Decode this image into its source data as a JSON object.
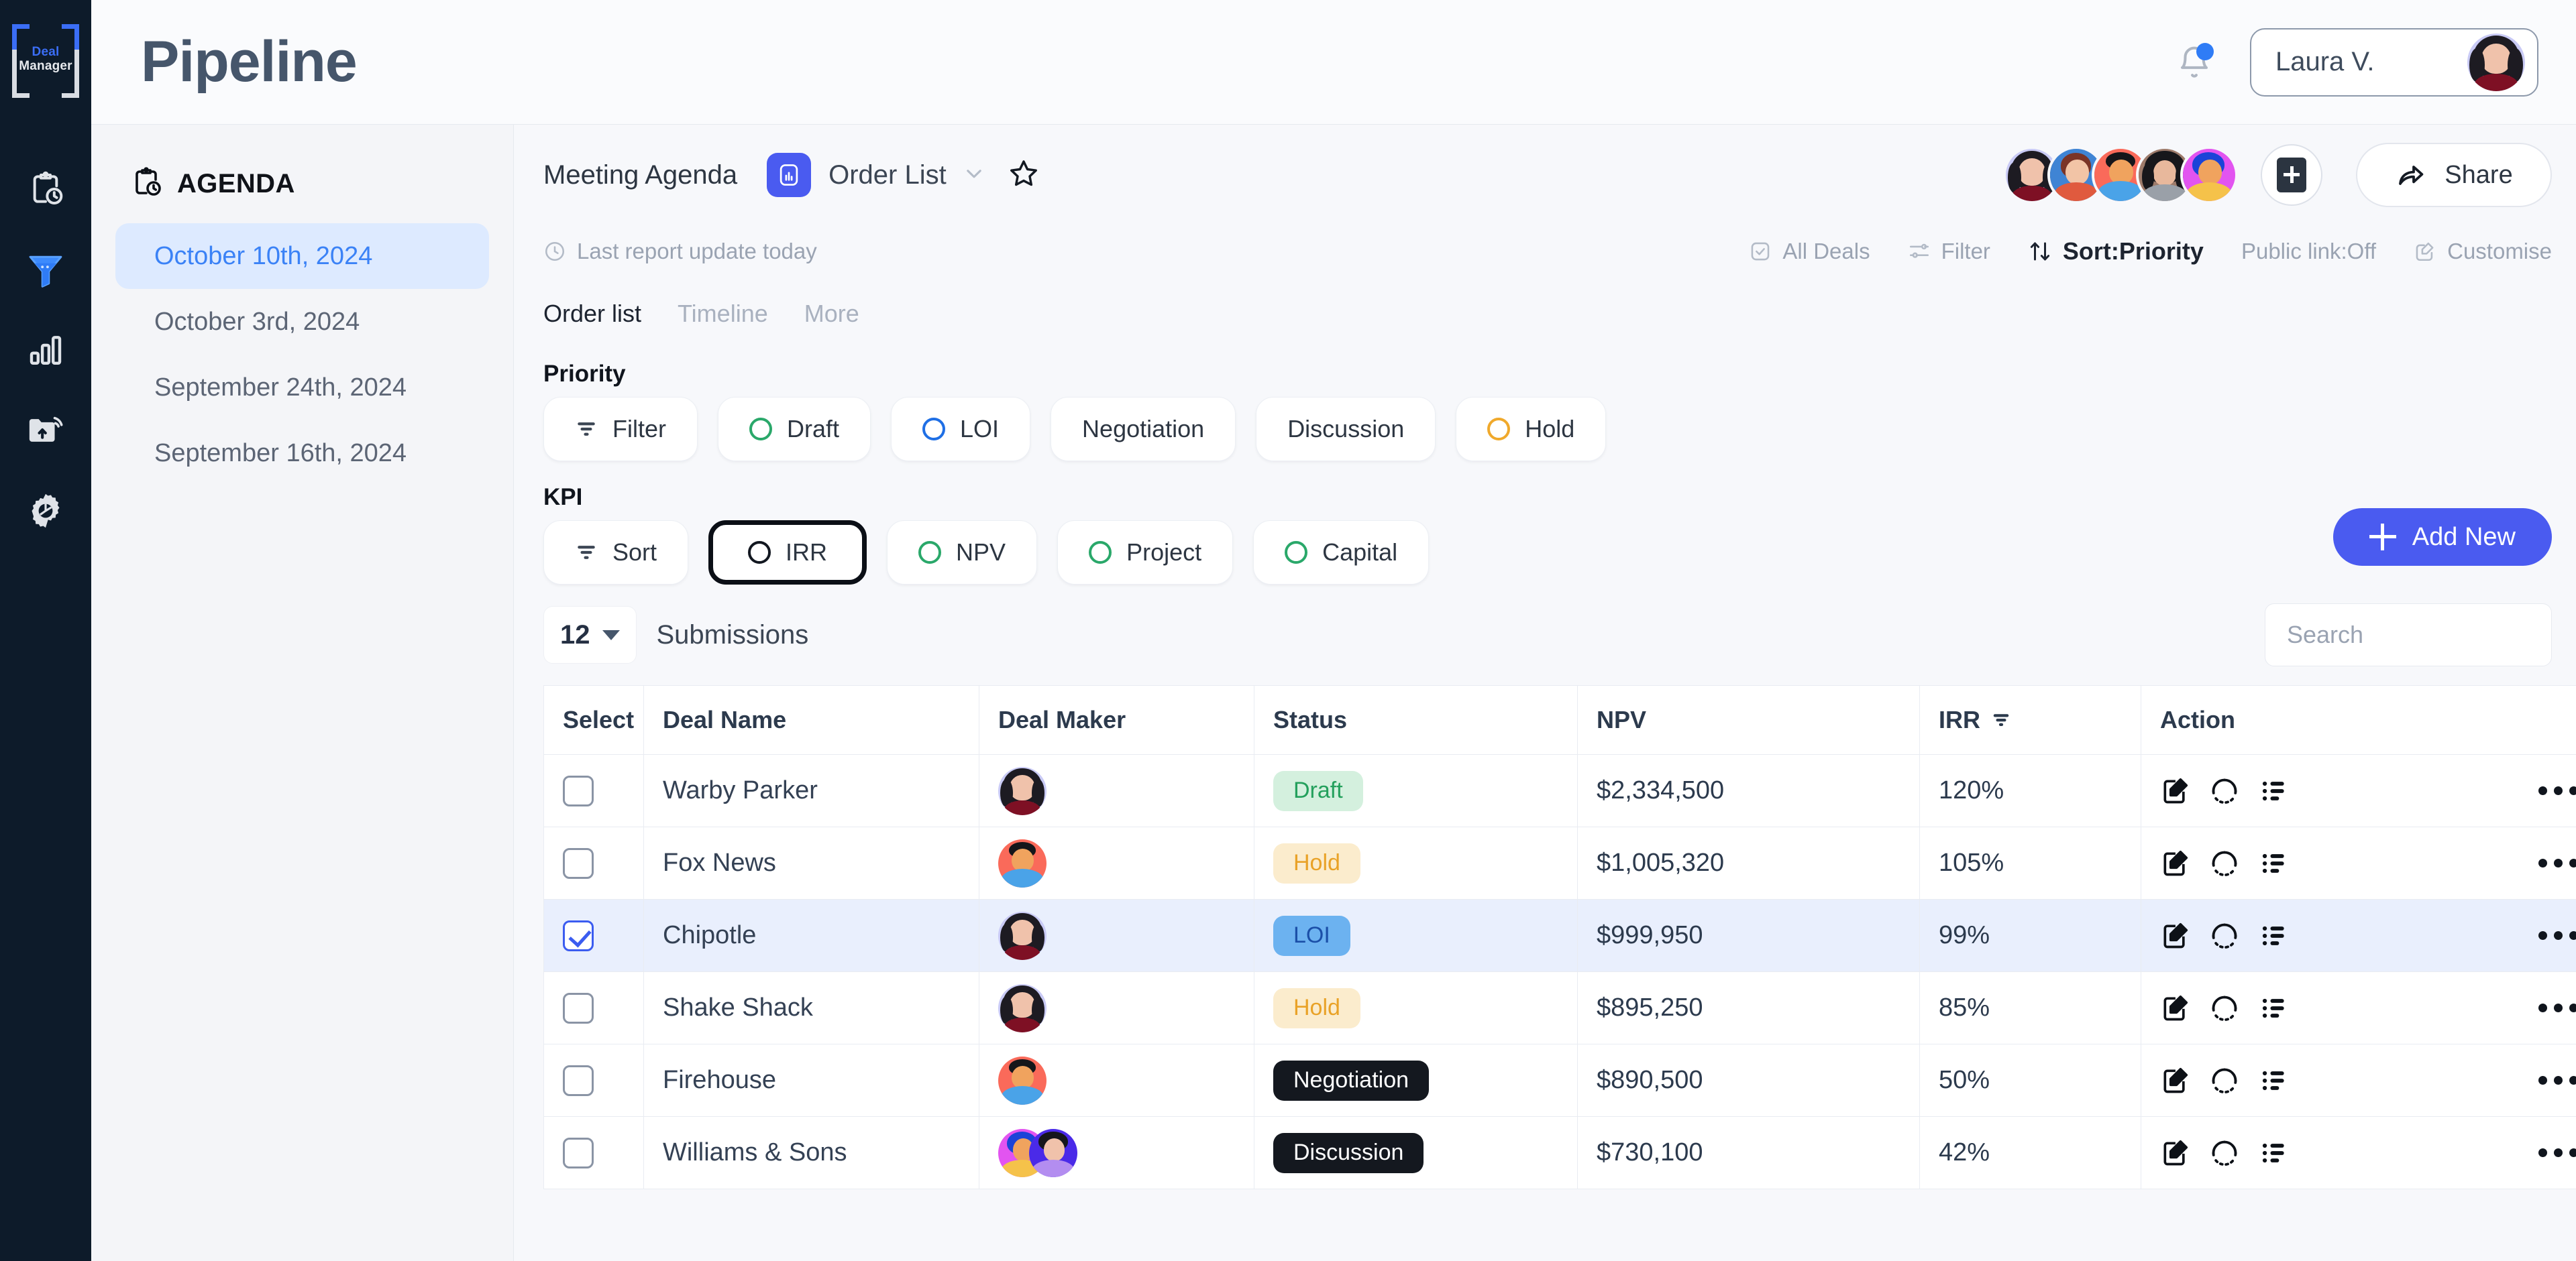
{
  "brand": {
    "line1": "Deal",
    "line2": "Manager"
  },
  "rail": {
    "items": [
      {
        "name": "clipboard-clock-icon",
        "label": "Agenda",
        "active": false
      },
      {
        "name": "funnel-icon",
        "label": "Pipeline",
        "active": true
      },
      {
        "name": "bar-chart-icon",
        "label": "Analytics",
        "active": false
      },
      {
        "name": "folder-upload-icon",
        "label": "Uploads",
        "active": false
      },
      {
        "name": "gear-icon",
        "label": "Settings",
        "active": false
      }
    ]
  },
  "header": {
    "title": "Pipeline",
    "notification_icon": "bell-icon",
    "has_notification": true,
    "user": {
      "name": "Laura V.",
      "avatar": "avatar-laura"
    }
  },
  "agenda": {
    "icon": "clipboard-clock-icon",
    "title": "AGENDA",
    "items": [
      {
        "label": "October 10th, 2024",
        "active": true
      },
      {
        "label": "October 3rd, 2024",
        "active": false
      },
      {
        "label": "September 24th, 2024",
        "active": false
      },
      {
        "label": "September 16th, 2024",
        "active": false
      }
    ]
  },
  "workspace": {
    "breadcrumb": "Meeting Agenda",
    "view_icon": "bar-chart-tile-icon",
    "view_name": "Order List",
    "chevron_icon": "chevron-down-icon",
    "favorite_icon": "star-icon",
    "collaborators": [
      {
        "name": "avatar-1"
      },
      {
        "name": "avatar-2"
      },
      {
        "name": "avatar-3"
      },
      {
        "name": "avatar-4"
      },
      {
        "name": "avatar-5"
      }
    ],
    "add_member_icon": "plus-square-icon",
    "share_label": "Share",
    "share_icon": "share-arrow-icon"
  },
  "status_bar": {
    "last_update": "Last report update today",
    "clock_icon": "clock-icon",
    "tools": [
      {
        "label": "All Deals",
        "icon": "checkbox-icon",
        "strong": false
      },
      {
        "label": "Filter",
        "icon": "sliders-icon",
        "strong": false
      },
      {
        "label": "Sort:Priority",
        "icon": "sort-arrows-icon",
        "strong": true
      },
      {
        "label": "Public link:Off",
        "icon": "",
        "strong": false
      },
      {
        "label": "Customise",
        "icon": "edit-square-icon",
        "strong": false
      }
    ]
  },
  "tabs": [
    {
      "label": "Order list",
      "active": true
    },
    {
      "label": "Timeline",
      "active": false
    },
    {
      "label": "More",
      "active": false
    }
  ],
  "priority": {
    "label": "Priority",
    "filter_button": {
      "label": "Filter",
      "icon": "filter-icon"
    },
    "chips": [
      {
        "label": "Draft",
        "ring": "green"
      },
      {
        "label": "LOI",
        "ring": "blue"
      },
      {
        "label": "Negotiation",
        "ring": "none"
      },
      {
        "label": "Discussion",
        "ring": "none"
      },
      {
        "label": "Hold",
        "ring": "amber"
      }
    ]
  },
  "kpi": {
    "label": "KPI",
    "sort_button": {
      "label": "Sort",
      "icon": "sort-icon"
    },
    "chips": [
      {
        "label": "IRR",
        "ring": "dark",
        "selected": true
      },
      {
        "label": "NPV",
        "ring": "green",
        "selected": false
      },
      {
        "label": "Project",
        "ring": "green",
        "selected": false
      },
      {
        "label": "Capital",
        "ring": "green",
        "selected": false
      }
    ],
    "add_new_label": "Add New"
  },
  "submissions": {
    "count": "12",
    "label": "Submissions",
    "dropdown_icon": "triangle-down-icon"
  },
  "search": {
    "placeholder": "Search",
    "value": "",
    "icon": "search-icon"
  },
  "table": {
    "columns": [
      {
        "key": "select",
        "label": "Select"
      },
      {
        "key": "deal_name",
        "label": "Deal Name"
      },
      {
        "key": "deal_maker",
        "label": "Deal Maker"
      },
      {
        "key": "status",
        "label": "Status"
      },
      {
        "key": "npv",
        "label": "NPV"
      },
      {
        "key": "irr",
        "label": "IRR",
        "icon": "filter-icon"
      },
      {
        "key": "action",
        "label": "Action"
      }
    ],
    "action_icons": [
      "edit-square-icon",
      "dotted-circle-icon",
      "list-icon",
      "more-dots-icon"
    ],
    "rows": [
      {
        "selected": false,
        "deal_name": "Warby Parker",
        "maker": "avatar-laura",
        "status": "Draft",
        "status_style": "draft",
        "npv": "$2,334,500",
        "irr": "120%"
      },
      {
        "selected": false,
        "deal_name": "Fox News",
        "maker": "avatar-red",
        "status": "Hold",
        "status_style": "hold",
        "npv": "$1,005,320",
        "irr": "105%"
      },
      {
        "selected": true,
        "deal_name": "Chipotle",
        "maker": "avatar-laura",
        "status": "LOI",
        "status_style": "loi",
        "npv": "$999,950",
        "irr": "99%"
      },
      {
        "selected": false,
        "deal_name": "Shake Shack",
        "maker": "avatar-laura",
        "status": "Hold",
        "status_style": "hold",
        "npv": "$895,250",
        "irr": "85%"
      },
      {
        "selected": false,
        "deal_name": "Firehouse",
        "maker": "avatar-red",
        "status": "Negotiation",
        "status_style": "dark",
        "npv": "$890,500",
        "irr": "50%"
      },
      {
        "selected": false,
        "deal_name": "Williams & Sons",
        "maker": "avatar-pair",
        "status": "Discussion",
        "status_style": "dark",
        "npv": "$730,100",
        "irr": "42%"
      }
    ]
  },
  "colors": {
    "accent_blue": "#4a5bf0",
    "rail_bg": "#0d1b2a",
    "active_agenda": "#3b82f6",
    "badge_draft": "#23a05c",
    "badge_hold": "#e9a227",
    "badge_loi": "#1b4fa8",
    "badge_dark": "#14181f"
  }
}
